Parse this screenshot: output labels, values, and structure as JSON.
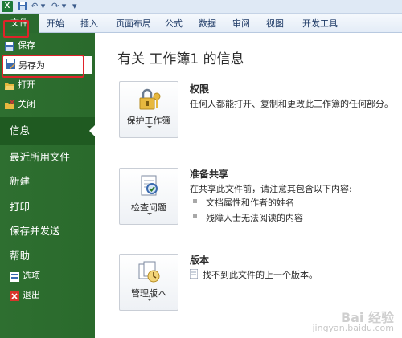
{
  "titlebar": {
    "app_icon_letter": "X",
    "undo_glyph": "↶ ▾",
    "redo_glyph": "↷ ▾",
    "quick_access": "▾"
  },
  "ribbon": {
    "file_tab": "文件",
    "tabs": [
      "开始",
      "插入",
      "页面布局",
      "公式",
      "数据",
      "审阅",
      "视图",
      "开发工具"
    ]
  },
  "nav": {
    "save": "保存",
    "save_as": "另存为",
    "open": "打开",
    "close": "关闭",
    "info": "信息",
    "recent": "最近所用文件",
    "new": "新建",
    "print": "打印",
    "save_send": "保存并发送",
    "help": "帮助",
    "options": "选项",
    "exit": "退出"
  },
  "main": {
    "title": "有关 工作簿1 的信息",
    "permissions": {
      "button": "保护工作簿",
      "heading": "权限",
      "text": "任何人都能打开、复制和更改此工作簿的任何部分。"
    },
    "prepare": {
      "button": "检查问题",
      "heading": "准备共享",
      "text": "在共享此文件前，请注意其包含以下内容:",
      "items": [
        "文档属性和作者的姓名",
        "残障人士无法阅读的内容"
      ]
    },
    "versions": {
      "button": "管理版本",
      "heading": "版本",
      "text": "找不到此文件的上一个版本。"
    }
  },
  "watermark": {
    "line1": "Bai 经验",
    "line2": "jingyan.baidu.com"
  },
  "colors": {
    "backstage_green": "#2a6a2c",
    "selected_green": "#1f5a21",
    "annotation_red": "#e0232a"
  }
}
